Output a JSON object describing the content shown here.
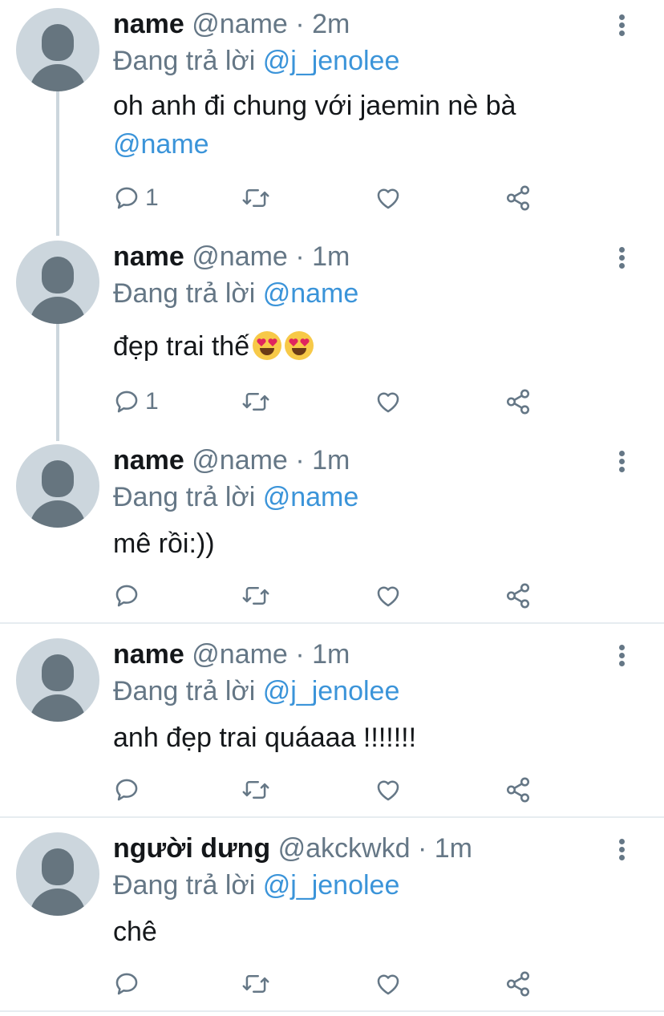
{
  "colors": {
    "username": "#14171a",
    "meta": "#657786",
    "mention": "#3b94d9",
    "avatar_bg": "#ccd6dd",
    "avatar_fg": "#66757f",
    "separator": "#e6ecf0"
  },
  "icons": {
    "reply": "reply-icon",
    "retweet": "retweet-icon",
    "like": "heart-icon",
    "share": "share-icon",
    "more": "more-vertical-icon",
    "avatar": "default-avatar-icon"
  },
  "tweets": [
    {
      "name": "name",
      "handle": "@name",
      "time": "2m",
      "replying_prefix": "Đang trả lời",
      "replying_to": "@j_jenolee",
      "text": "oh anh đi chung với jaemin nè bà",
      "text_mention": "@name",
      "reply_count": "1"
    },
    {
      "name": "name",
      "handle": "@name",
      "time": "1m",
      "replying_prefix": "Đang trả lời",
      "replying_to": "@name",
      "text": "đẹp trai thế",
      "emoji": "heart-eyes-emoji",
      "reply_count": "1"
    },
    {
      "name": "name",
      "handle": "@name",
      "time": "1m",
      "replying_prefix": "Đang trả lời",
      "replying_to": "@name",
      "text": "mê rồi:))",
      "reply_count": ""
    },
    {
      "name": "name",
      "handle": "@name",
      "time": "1m",
      "replying_prefix": "Đang trả lời",
      "replying_to": "@j_jenolee",
      "text": "anh đẹp trai quáaaa !!!!!!!",
      "reply_count": ""
    },
    {
      "name": "người dưng",
      "handle": "@akckwkd",
      "time": "1m",
      "replying_prefix": "Đang trả lời",
      "replying_to": "@j_jenolee",
      "text": "chê",
      "reply_count": ""
    }
  ]
}
